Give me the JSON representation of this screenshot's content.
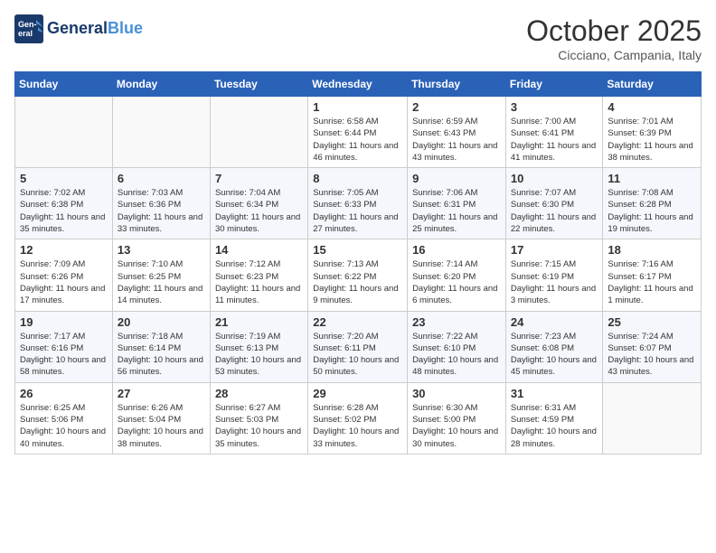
{
  "header": {
    "logo_line1": "General",
    "logo_line2": "Blue",
    "title": "October 2025",
    "subtitle": "Cicciano, Campania, Italy"
  },
  "calendar": {
    "weekdays": [
      "Sunday",
      "Monday",
      "Tuesday",
      "Wednesday",
      "Thursday",
      "Friday",
      "Saturday"
    ],
    "weeks": [
      [
        {
          "day": "",
          "info": ""
        },
        {
          "day": "",
          "info": ""
        },
        {
          "day": "",
          "info": ""
        },
        {
          "day": "1",
          "info": "Sunrise: 6:58 AM\nSunset: 6:44 PM\nDaylight: 11 hours and 46 minutes."
        },
        {
          "day": "2",
          "info": "Sunrise: 6:59 AM\nSunset: 6:43 PM\nDaylight: 11 hours and 43 minutes."
        },
        {
          "day": "3",
          "info": "Sunrise: 7:00 AM\nSunset: 6:41 PM\nDaylight: 11 hours and 41 minutes."
        },
        {
          "day": "4",
          "info": "Sunrise: 7:01 AM\nSunset: 6:39 PM\nDaylight: 11 hours and 38 minutes."
        }
      ],
      [
        {
          "day": "5",
          "info": "Sunrise: 7:02 AM\nSunset: 6:38 PM\nDaylight: 11 hours and 35 minutes."
        },
        {
          "day": "6",
          "info": "Sunrise: 7:03 AM\nSunset: 6:36 PM\nDaylight: 11 hours and 33 minutes."
        },
        {
          "day": "7",
          "info": "Sunrise: 7:04 AM\nSunset: 6:34 PM\nDaylight: 11 hours and 30 minutes."
        },
        {
          "day": "8",
          "info": "Sunrise: 7:05 AM\nSunset: 6:33 PM\nDaylight: 11 hours and 27 minutes."
        },
        {
          "day": "9",
          "info": "Sunrise: 7:06 AM\nSunset: 6:31 PM\nDaylight: 11 hours and 25 minutes."
        },
        {
          "day": "10",
          "info": "Sunrise: 7:07 AM\nSunset: 6:30 PM\nDaylight: 11 hours and 22 minutes."
        },
        {
          "day": "11",
          "info": "Sunrise: 7:08 AM\nSunset: 6:28 PM\nDaylight: 11 hours and 19 minutes."
        }
      ],
      [
        {
          "day": "12",
          "info": "Sunrise: 7:09 AM\nSunset: 6:26 PM\nDaylight: 11 hours and 17 minutes."
        },
        {
          "day": "13",
          "info": "Sunrise: 7:10 AM\nSunset: 6:25 PM\nDaylight: 11 hours and 14 minutes."
        },
        {
          "day": "14",
          "info": "Sunrise: 7:12 AM\nSunset: 6:23 PM\nDaylight: 11 hours and 11 minutes."
        },
        {
          "day": "15",
          "info": "Sunrise: 7:13 AM\nSunset: 6:22 PM\nDaylight: 11 hours and 9 minutes."
        },
        {
          "day": "16",
          "info": "Sunrise: 7:14 AM\nSunset: 6:20 PM\nDaylight: 11 hours and 6 minutes."
        },
        {
          "day": "17",
          "info": "Sunrise: 7:15 AM\nSunset: 6:19 PM\nDaylight: 11 hours and 3 minutes."
        },
        {
          "day": "18",
          "info": "Sunrise: 7:16 AM\nSunset: 6:17 PM\nDaylight: 11 hours and 1 minute."
        }
      ],
      [
        {
          "day": "19",
          "info": "Sunrise: 7:17 AM\nSunset: 6:16 PM\nDaylight: 10 hours and 58 minutes."
        },
        {
          "day": "20",
          "info": "Sunrise: 7:18 AM\nSunset: 6:14 PM\nDaylight: 10 hours and 56 minutes."
        },
        {
          "day": "21",
          "info": "Sunrise: 7:19 AM\nSunset: 6:13 PM\nDaylight: 10 hours and 53 minutes."
        },
        {
          "day": "22",
          "info": "Sunrise: 7:20 AM\nSunset: 6:11 PM\nDaylight: 10 hours and 50 minutes."
        },
        {
          "day": "23",
          "info": "Sunrise: 7:22 AM\nSunset: 6:10 PM\nDaylight: 10 hours and 48 minutes."
        },
        {
          "day": "24",
          "info": "Sunrise: 7:23 AM\nSunset: 6:08 PM\nDaylight: 10 hours and 45 minutes."
        },
        {
          "day": "25",
          "info": "Sunrise: 7:24 AM\nSunset: 6:07 PM\nDaylight: 10 hours and 43 minutes."
        }
      ],
      [
        {
          "day": "26",
          "info": "Sunrise: 6:25 AM\nSunset: 5:06 PM\nDaylight: 10 hours and 40 minutes."
        },
        {
          "day": "27",
          "info": "Sunrise: 6:26 AM\nSunset: 5:04 PM\nDaylight: 10 hours and 38 minutes."
        },
        {
          "day": "28",
          "info": "Sunrise: 6:27 AM\nSunset: 5:03 PM\nDaylight: 10 hours and 35 minutes."
        },
        {
          "day": "29",
          "info": "Sunrise: 6:28 AM\nSunset: 5:02 PM\nDaylight: 10 hours and 33 minutes."
        },
        {
          "day": "30",
          "info": "Sunrise: 6:30 AM\nSunset: 5:00 PM\nDaylight: 10 hours and 30 minutes."
        },
        {
          "day": "31",
          "info": "Sunrise: 6:31 AM\nSunset: 4:59 PM\nDaylight: 10 hours and 28 minutes."
        },
        {
          "day": "",
          "info": ""
        }
      ]
    ]
  }
}
